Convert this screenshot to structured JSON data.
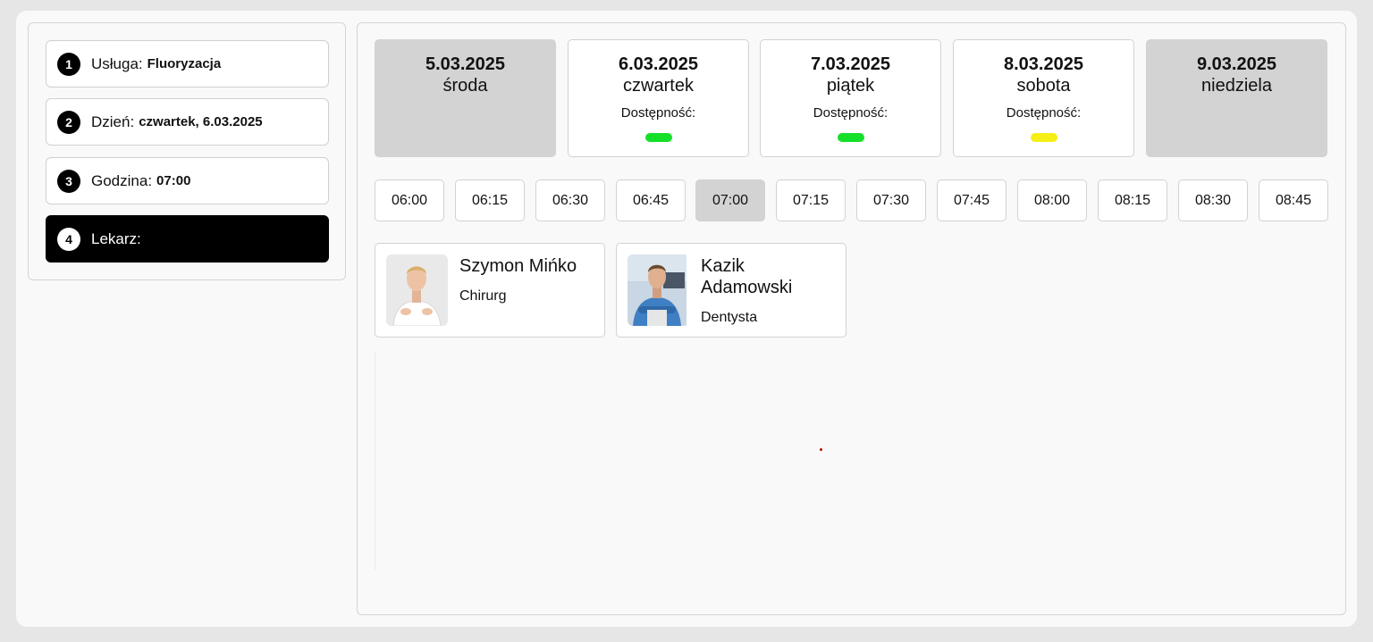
{
  "steps": [
    {
      "number": "1",
      "label": "Usługa:",
      "value": "Fluoryzacja",
      "active": false
    },
    {
      "number": "2",
      "label": "Dzień:",
      "value": "czwartek, 6.03.2025",
      "active": false
    },
    {
      "number": "3",
      "label": "Godzina:",
      "value": "07:00",
      "active": false
    },
    {
      "number": "4",
      "label": "Lekarz:",
      "value": "",
      "active": true
    }
  ],
  "availability_label": "Dostępność:",
  "days": [
    {
      "date": "5.03.2025",
      "name": "środa",
      "available": false,
      "availability_color": ""
    },
    {
      "date": "6.03.2025",
      "name": "czwartek",
      "available": true,
      "availability_color": "#14e02a"
    },
    {
      "date": "7.03.2025",
      "name": "piątek",
      "available": true,
      "availability_color": "#14e02a"
    },
    {
      "date": "8.03.2025",
      "name": "sobota",
      "available": true,
      "availability_color": "#f7ee16"
    },
    {
      "date": "9.03.2025",
      "name": "niedziela",
      "available": false,
      "availability_color": ""
    }
  ],
  "times": [
    "06:00",
    "06:15",
    "06:30",
    "06:45",
    "07:00",
    "07:15",
    "07:30",
    "07:45",
    "08:00",
    "08:15",
    "08:30",
    "08:45"
  ],
  "selected_time": "07:00",
  "doctors": [
    {
      "name": "Szymon Mińko",
      "role": "Chirurg"
    },
    {
      "name": "Kazik Adamowski",
      "role": "Dentysta"
    }
  ],
  "colors": {
    "active_step": "#000000",
    "disabled_day": "#d3d3d3",
    "available_high": "#14e02a",
    "available_medium": "#f7ee16"
  }
}
